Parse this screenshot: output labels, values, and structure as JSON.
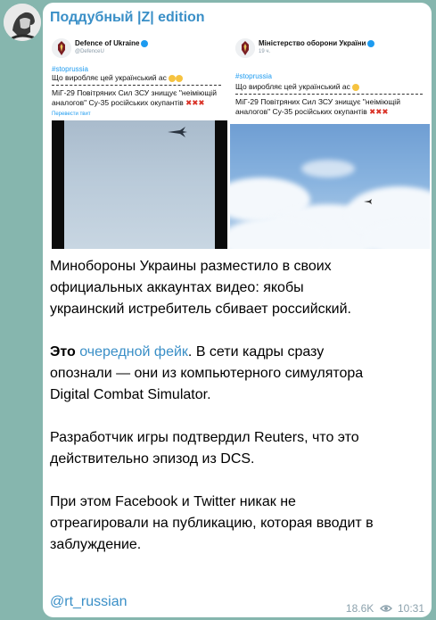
{
  "channel": {
    "name": "Поддубный |Z| edition"
  },
  "left_post": {
    "account_name": "Defence of Ukraine",
    "handle": "@DefenceU",
    "hashtag": "#stopruss​ia",
    "line1": "Що виробляє цей український ас",
    "headline": "МіГ-29 Повітряних Сил ЗСУ знищує \"неіміющій аналогов\" Су-35 російських окупантів",
    "xxx": "✖✖✖",
    "translate": "Перевести твит"
  },
  "right_post": {
    "account_name": "Міністерство оборони України",
    "time": "19 ч.",
    "hashtag": "#stopruss​ia",
    "line1": "Що виробляє цей український ас",
    "headline": "МіГ-29 Повітряних Сил ЗСУ знищує \"неіміющій аналогов\" Су-35 російських окупантів",
    "xxx": "✖✖✖"
  },
  "message": {
    "p1": [
      "Минобороны Украины разместило в своих",
      "официальных аккаунтах видео: якобы",
      "украинский истребитель сбивает российский."
    ],
    "p2_bold": "Это",
    "p2_link": "очередной фейк",
    "p2_rest": ". В сети кадры сразу",
    "p2_lines": [
      "опознали — они из компьютерного симулятора",
      "Digital Combat Simulator."
    ],
    "p3": [
      "Разработчик игры подтвердил Reuters, что это",
      "действительно эпизод из DCS."
    ],
    "p4": [
      "При этом Facebook и Twitter никак не",
      "отреагировали на публикацию, которая вводит в",
      "заблуждение."
    ],
    "mention": "@rt_russian"
  },
  "meta": {
    "views": "18.6K",
    "time": "10:31"
  },
  "colors": {
    "background": "#86b6ae",
    "link": "#3a8fc7",
    "meta": "#8ca2ad"
  },
  "icons": [
    "avatar",
    "eye-icon",
    "emblem-icon",
    "verified-icon",
    "jet-icon"
  ]
}
